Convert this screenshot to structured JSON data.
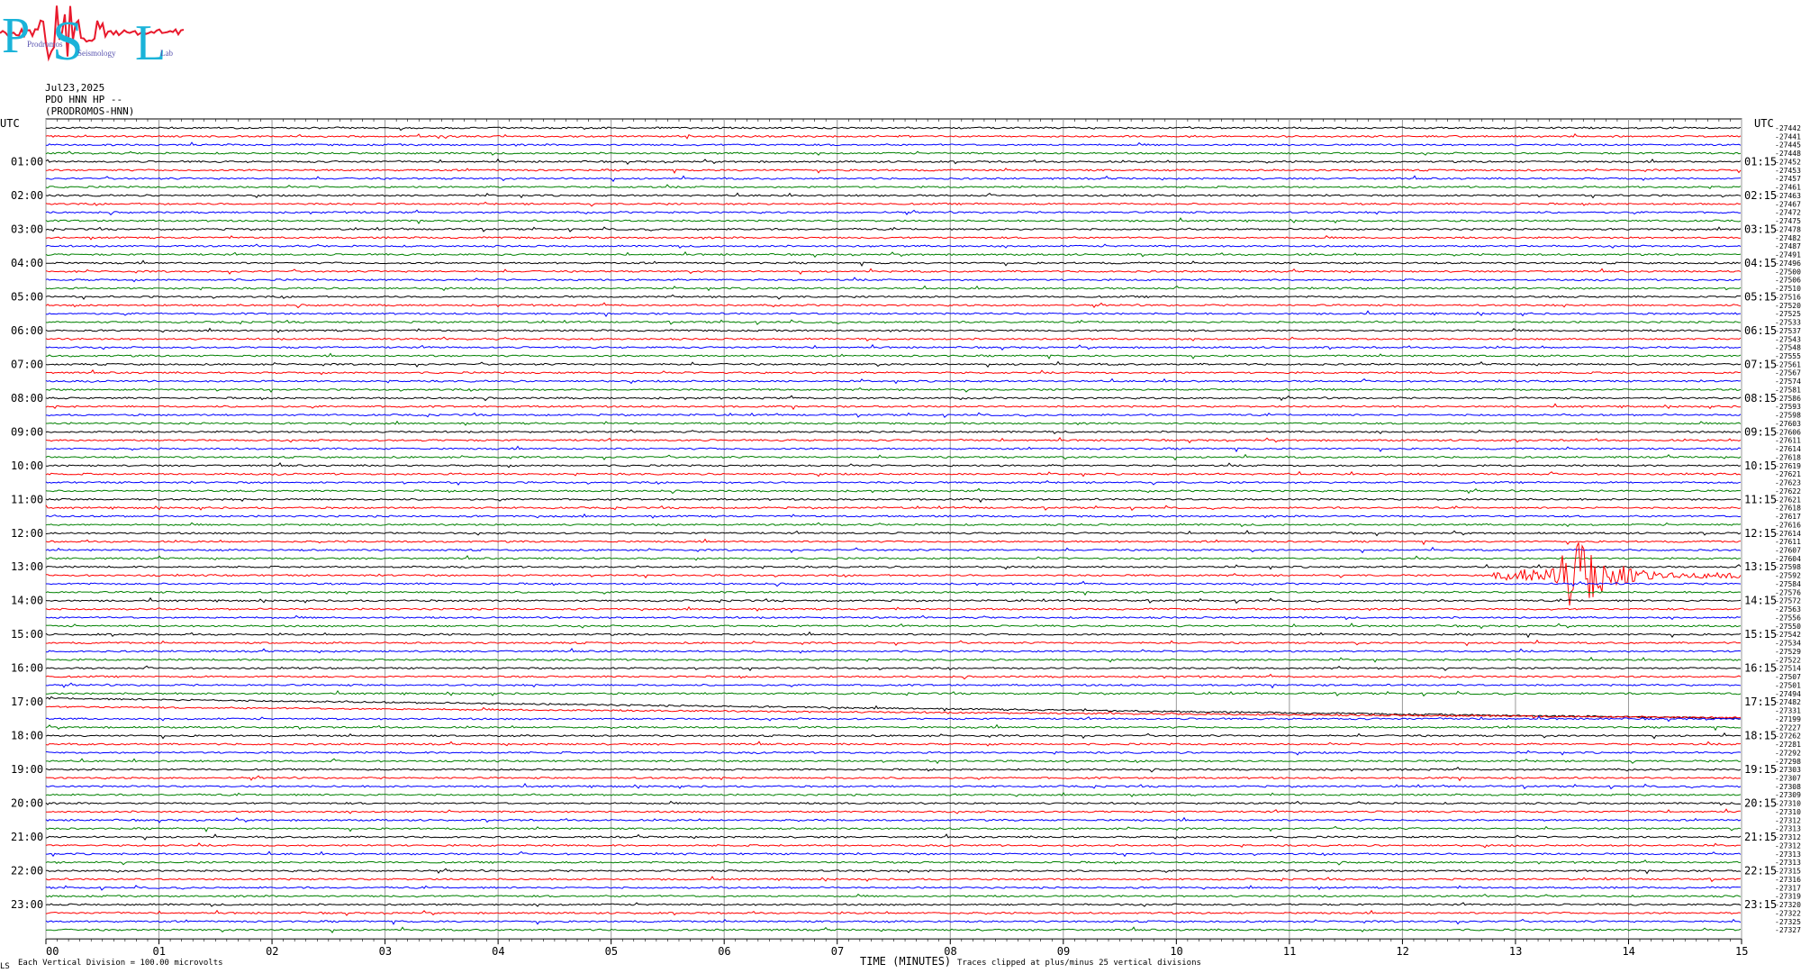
{
  "logo": {
    "letters": [
      "P",
      "S",
      "L"
    ],
    "words": [
      "Prodromos",
      "Seismology",
      "Lab"
    ],
    "colors": {
      "letters": "#1ab3d9",
      "waveform": "#e8192c",
      "words": "#5a55b0"
    }
  },
  "header": {
    "date": "Jul23,2025",
    "station": "PDO HNN HP --",
    "site": "(PRODROMOS-HNN)"
  },
  "footer": {
    "vertical_division": "Each Vertical Division =  100.00 microvolts",
    "xaxis_title": "TIME (MINUTES)",
    "clip_note": "Traces clipped at plus/minus 25 vertical divisions",
    "corner_mark": "LS"
  },
  "chart_data": {
    "type": "line",
    "title": "",
    "xlabel": "TIME (MINUTES)",
    "xlim": [
      0,
      15
    ],
    "x_ticks": [
      "00",
      "01",
      "02",
      "03",
      "04",
      "05",
      "06",
      "07",
      "08",
      "09",
      "10",
      "11",
      "12",
      "13",
      "14",
      "15"
    ],
    "left_header": "UTC",
    "right_header": "UTC",
    "left_hour_labels": [
      "01:00",
      "02:00",
      "03:00",
      "04:00",
      "05:00",
      "06:00",
      "07:00",
      "08:00",
      "09:00",
      "10:00",
      "11:00",
      "12:00",
      "13:00",
      "14:00",
      "15:00",
      "16:00",
      "17:00",
      "18:00",
      "19:00",
      "20:00",
      "21:00",
      "22:00",
      "23:00"
    ],
    "right_hour_labels": [
      "01:15",
      "02:15",
      "03:15",
      "04:15",
      "05:15",
      "06:15",
      "07:15",
      "08:15",
      "09:15",
      "10:15",
      "11:15",
      "12:15",
      "13:15",
      "14:15",
      "15:15",
      "16:15",
      "17:15",
      "18:15",
      "19:15",
      "20:15",
      "21:15",
      "22:15",
      "23:15"
    ],
    "trace_minutes": 15,
    "trace_colors": [
      "#000000",
      "#ff0000",
      "#0000ff",
      "#008000"
    ],
    "trace_offsets": [
      -27442,
      -27441,
      -27445,
      -27448,
      -27452,
      -27453,
      -27457,
      -27461,
      -27463,
      -27467,
      -27472,
      -27475,
      -27478,
      -27482,
      -27487,
      -27491,
      -27496,
      -27500,
      -27506,
      -27510,
      -27516,
      -27520,
      -27525,
      -27533,
      -27537,
      -27543,
      -27548,
      -27555,
      -27561,
      -27567,
      -27574,
      -27581,
      -27586,
      -27593,
      -27598,
      -27603,
      -27606,
      -27611,
      -27614,
      -27618,
      -27619,
      -27621,
      -27623,
      -27622,
      -27621,
      -27618,
      -27617,
      -27616,
      -27614,
      -27611,
      -27607,
      -27604,
      -27598,
      -27592,
      -27584,
      -27576,
      -27572,
      -27563,
      -27556,
      -27550,
      -27542,
      -27534,
      -27529,
      -27522,
      -27514,
      -27507,
      -27501,
      -27494,
      -27482,
      -27331,
      -27199,
      -27227,
      -27262,
      -27281,
      -27292,
      -27298,
      -27303,
      -27307,
      -27308,
      -27309,
      -27310,
      -27310,
      -27312,
      -27313,
      -27312,
      -27312,
      -27313,
      -27313,
      -27315,
      -27316,
      -27317,
      -27319,
      -27320,
      -27322,
      -27325,
      -27327
    ],
    "events": [
      {
        "trace": 53,
        "start_min": 12.8,
        "peak_min": 13.55,
        "end_min": 15.0,
        "color": "#ff0000",
        "description": "earthquake"
      }
    ],
    "grid": true
  }
}
